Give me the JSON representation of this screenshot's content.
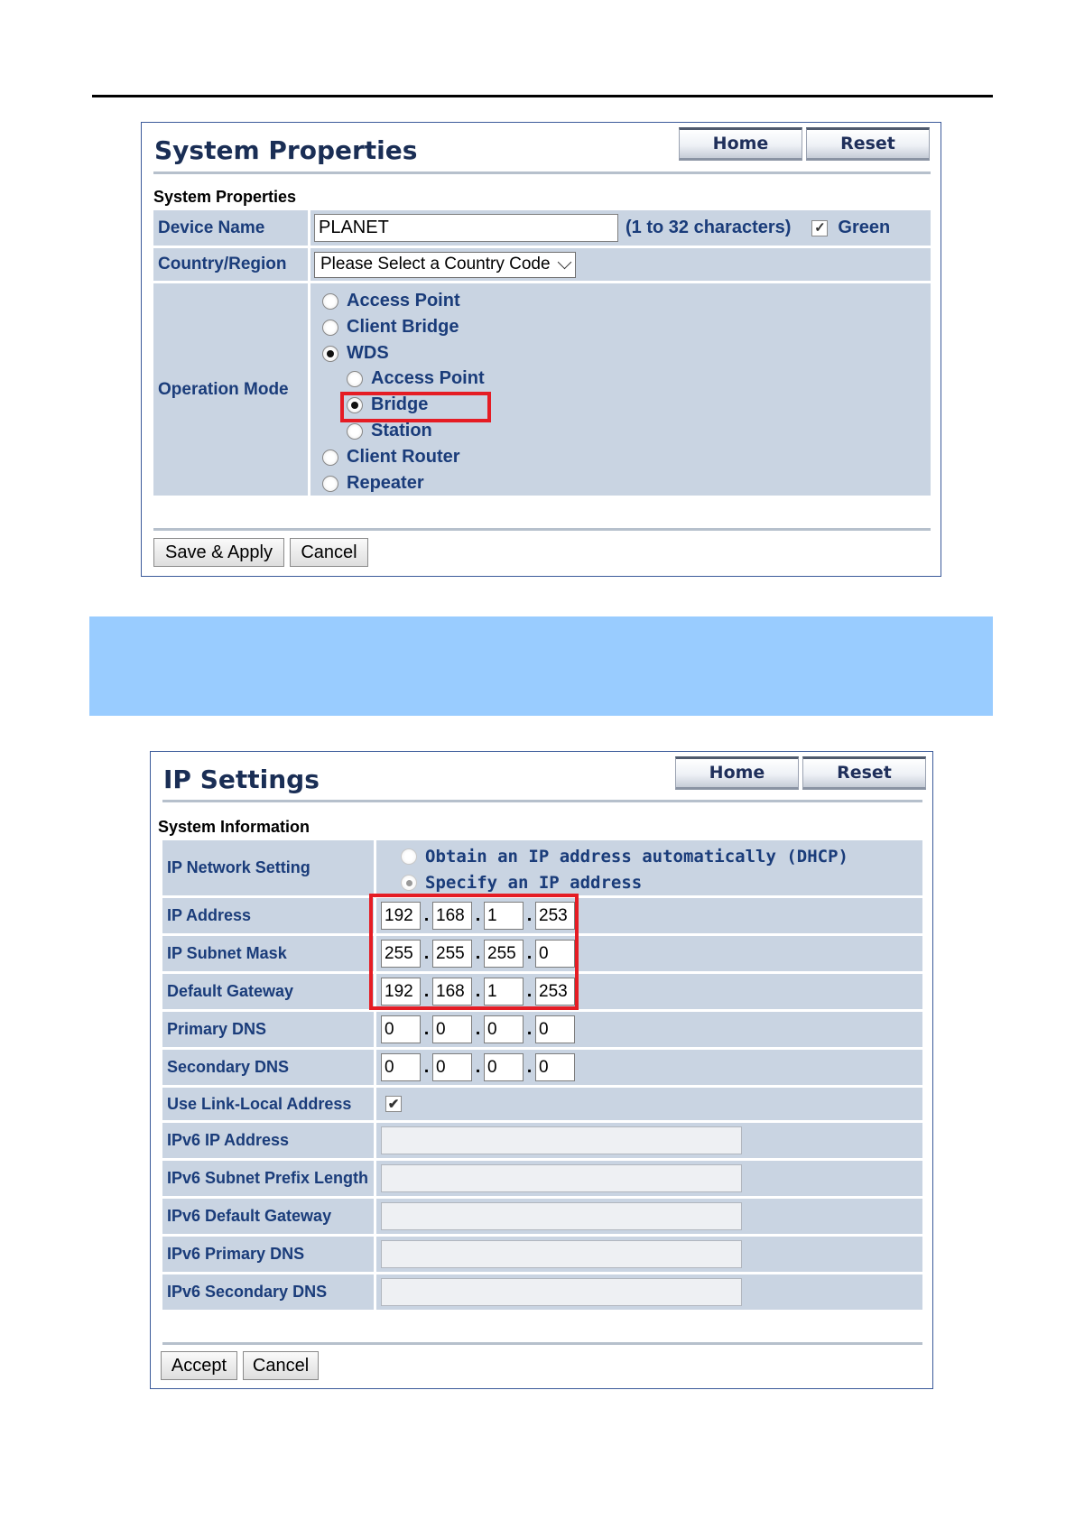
{
  "system_properties": {
    "title": "System Properties",
    "home_label": "Home",
    "reset_label": "Reset",
    "section_label": "System Properties",
    "device_name_label": "Device Name",
    "device_name_value": "PLANET",
    "device_name_hint": "(1 to 32 characters)",
    "green_label": "Green",
    "green_checked": true,
    "country_label": "Country/Region",
    "country_value": "Please Select a Country Code",
    "operation_mode_label": "Operation Mode",
    "modes": [
      {
        "label": "Access Point",
        "selected": false
      },
      {
        "label": "Client Bridge",
        "selected": false
      },
      {
        "label": "WDS",
        "selected": true
      },
      {
        "label": "Access Point",
        "selected": false,
        "sub": true
      },
      {
        "label": "Bridge",
        "selected": true,
        "sub": true,
        "highlighted": true
      },
      {
        "label": "Station",
        "selected": false,
        "sub": true
      },
      {
        "label": "Client Router",
        "selected": false
      },
      {
        "label": "Repeater",
        "selected": false
      }
    ],
    "save_label": "Save & Apply",
    "cancel_label": "Cancel"
  },
  "ip_settings": {
    "title": "IP Settings",
    "home_label": "Home",
    "reset_label": "Reset",
    "section_label": "System Information",
    "network_setting_label": "IP Network Setting",
    "dhcp_label": "Obtain an IP address automatically (DHCP)",
    "specify_label": "Specify an IP address",
    "rows": [
      {
        "label": "IP Address",
        "octets": [
          "192",
          "168",
          "1",
          "253"
        ]
      },
      {
        "label": "IP Subnet Mask",
        "octets": [
          "255",
          "255",
          "255",
          "0"
        ]
      },
      {
        "label": "Default Gateway",
        "octets": [
          "192",
          "168",
          "1",
          "253"
        ]
      },
      {
        "label": "Primary DNS",
        "octets": [
          "0",
          "0",
          "0",
          "0"
        ]
      },
      {
        "label": "Secondary DNS",
        "octets": [
          "0",
          "0",
          "0",
          "0"
        ]
      }
    ],
    "link_local_label": "Use Link-Local Address",
    "link_local_checked": true,
    "ipv6_rows": [
      {
        "label": "IPv6 IP Address",
        "value": ""
      },
      {
        "label": "IPv6 Subnet Prefix Length",
        "value": ""
      },
      {
        "label": "IPv6 Default Gateway",
        "value": ""
      },
      {
        "label": "IPv6 Primary DNS",
        "value": ""
      },
      {
        "label": "IPv6 Secondary DNS",
        "value": ""
      }
    ],
    "accept_label": "Accept",
    "cancel_label": "Cancel"
  },
  "colors": {
    "highlight_box": "#e51c24",
    "banner": "#99ccff",
    "row_background": "#c9d4e2",
    "label_text": "#1a3c7a"
  }
}
